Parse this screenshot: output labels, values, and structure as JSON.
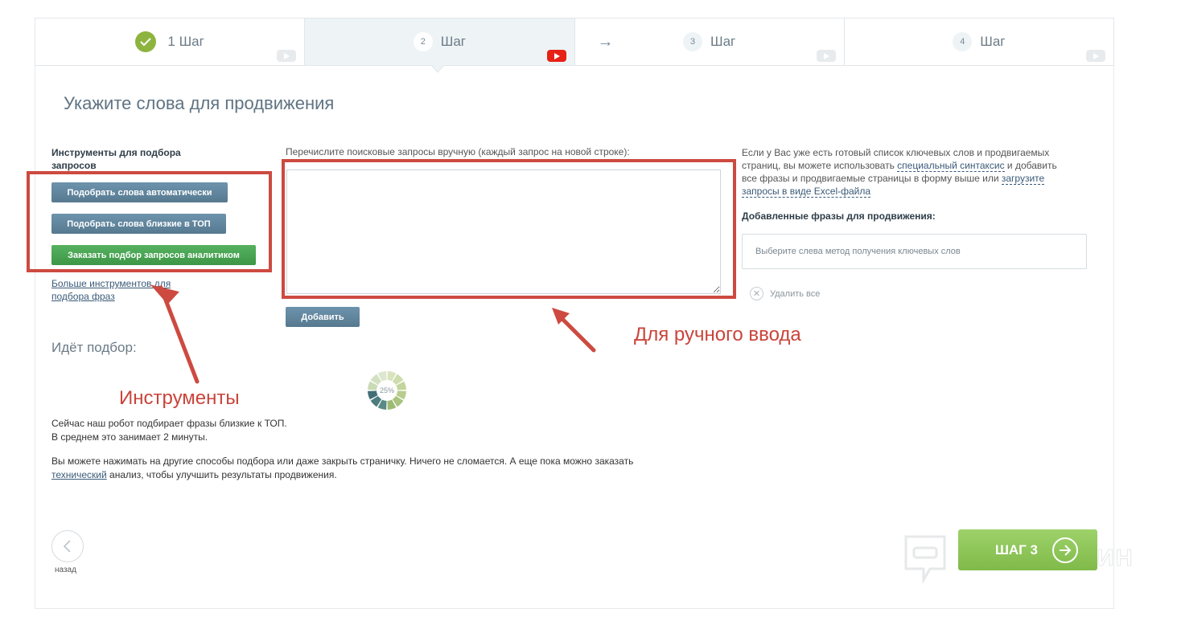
{
  "steps": [
    {
      "label": "1 Шаг",
      "state": "done"
    },
    {
      "number": "2",
      "label": "Шаг",
      "state": "active"
    },
    {
      "number": "3",
      "label": "Шаг",
      "state": "pending"
    },
    {
      "number": "4",
      "label": "Шаг",
      "state": "pending"
    }
  ],
  "page_title": "Укажите слова для продвижения",
  "tools": {
    "heading": "Инструменты для подбора запросов",
    "auto_button": "Подобрать слова автоматически",
    "top_button": "Подобрать слова близкие в ТОП",
    "analyst_button": "Заказать подбор запросов аналитиком",
    "more_link": "Больше инструментов для подбора фраз"
  },
  "progress": {
    "title": "Идёт подбор:",
    "percent_label": "25%",
    "percent": 25,
    "robot_line1": "Сейчас наш робот подбирает фразы близкие к ТОП.",
    "robot_line2": "В среднем это занимает 2 минуты.",
    "tip_part1": "Вы можете нажимать на другие способы подбора или даже закрыть страничку. Ничего не сломается. А еще пока можно заказать",
    "tip_link": "технический",
    "tip_part2": " анализ, чтобы улучшить результаты продвижения."
  },
  "manual": {
    "label": "Перечислите поисковые запросы вручную (каждый запрос на новой строке):",
    "value": "",
    "add_button": "Добавить"
  },
  "right": {
    "text_part1": "Если у Вас уже есть готовый список ключевых слов и продвигаемых страниц, вы можете использовать ",
    "syntax_link": "специальный синтаксис",
    "text_part2": " и добавить все фразы и продвигаемые страницы в форму выше или ",
    "excel_link": "загрузите запросы в виде Excel-файла",
    "added_heading": "Добавленные фразы для продвижения:",
    "added_placeholder": "Выберите слева метод получения ключевых слов",
    "delete_all": "Удалить все"
  },
  "annotations": {
    "tools_label": "Инструменты",
    "manual_label": "Для ручного ввода",
    "color": "#cd4a40"
  },
  "nav": {
    "back_label": "назад",
    "next_label": "ШАГ 3"
  },
  "watermark": "ПАРТНЕРКИН",
  "colors": {
    "accent_green": "#8db43f",
    "button_blue": "#5f859d",
    "button_green": "#48a452",
    "youtube_red": "#e62117"
  }
}
